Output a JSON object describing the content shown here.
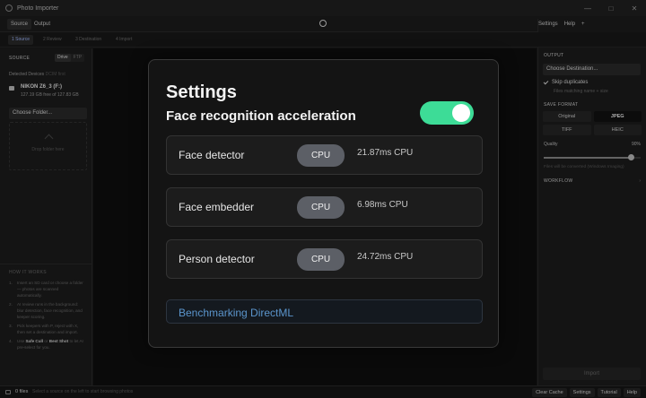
{
  "window": {
    "title": "Photo Importer",
    "controls": [
      "—",
      "□",
      "✕"
    ]
  },
  "menubar": {
    "tabs": [
      "Source",
      "Output"
    ],
    "right": [
      "Settings",
      "Help",
      "+"
    ]
  },
  "steps": [
    "1 Source",
    "2 Review",
    "3 Destination",
    "4 Import"
  ],
  "left": {
    "source_label": "SOURCE",
    "source_modes": [
      "Drive",
      "FTP"
    ],
    "detected_label": "Detected Devices",
    "detected_suffix": "DCIM first",
    "device": {
      "name": "NIKON Z6_3 (F:)",
      "size": "127.19 GB free of 127.83 GB"
    },
    "choose_folder": "Choose Folder...",
    "drop_text": "Drop folder here",
    "howto_label": "HOW IT WORKS",
    "howto": [
      {
        "num": "1.",
        "text": "Insert an SD card or choose a folder — photos are scanned automatically."
      },
      {
        "num": "2.",
        "text": "AI review runs in the background: blur detection, face recognition, and keeper scoring."
      },
      {
        "num": "3.",
        "text": "Pick keepers with P, reject with X, then set a destination and import."
      },
      {
        "num": "4.",
        "pre": "Use ",
        "b1": "Safe Cull",
        "mid": " or ",
        "b2": "Best Shot",
        "post": " to let AI pre-select for you."
      }
    ]
  },
  "right": {
    "output_label": "OUTPUT",
    "choose_destination": "Choose Destination...",
    "skip_duplicates": "Skip duplicates",
    "skip_sub": "Files matching name + size",
    "save_format_label": "SAVE FORMAT",
    "formats": [
      "Original",
      "JPEG",
      "TIFF",
      "HEIC"
    ],
    "selected_format": "JPEG",
    "quality_label": "Quality",
    "quality_value": "90%",
    "quality_fraction": 0.9,
    "convert_note": "Files will be converted (Windows Imaging)",
    "workflow_label": "WORKFLOW",
    "workflow_chevron": "›",
    "import_label": "Import"
  },
  "status": {
    "files": "0 files",
    "hint": "Select a source on the left to start browsing photos",
    "buttons": [
      "Clear Cache",
      "Settings",
      "Tutorial",
      "Help"
    ]
  },
  "modal": {
    "title": "Settings",
    "subtitle": "Face recognition acceleration",
    "toggle_on": true,
    "rows": [
      {
        "label": "Face detector",
        "device": "CPU",
        "time": "21.87ms CPU"
      },
      {
        "label": "Face embedder",
        "device": "CPU",
        "time": "6.98ms CPU"
      },
      {
        "label": "Person detector",
        "device": "CPU",
        "time": "24.72ms CPU"
      }
    ],
    "benchmark": "Benchmarking DirectML"
  },
  "colors": {
    "toggle": "#3ddc97",
    "accent_link": "#5b95cc",
    "step_active": "#9fb8ff"
  }
}
